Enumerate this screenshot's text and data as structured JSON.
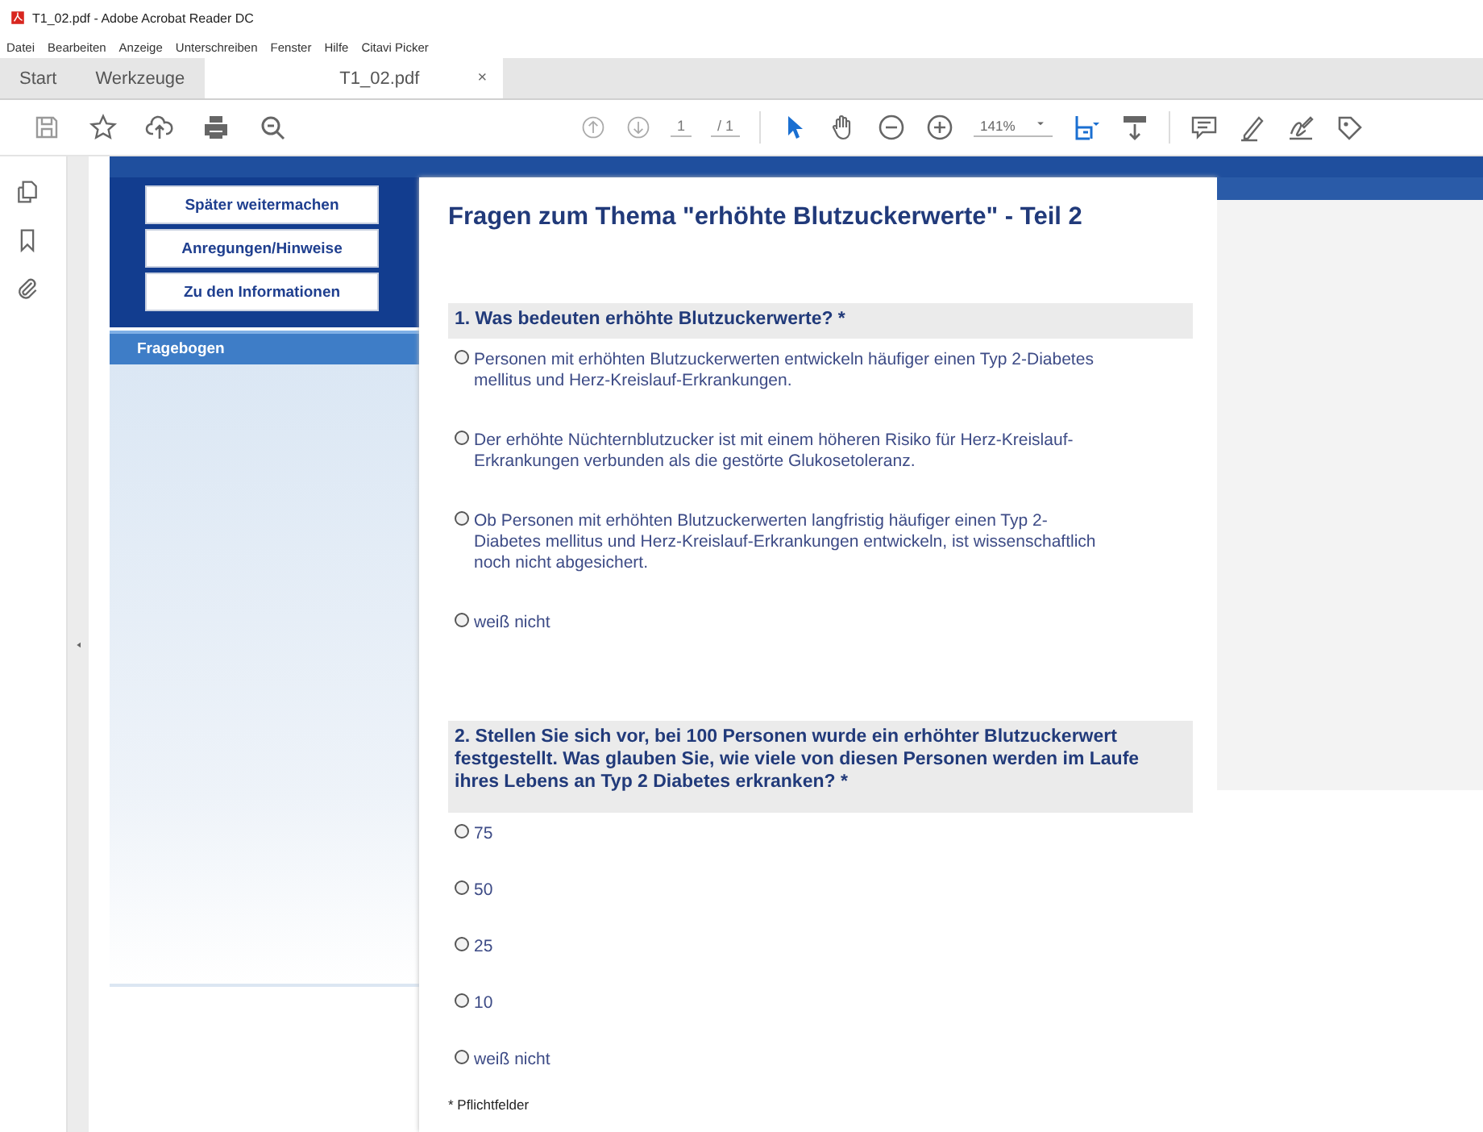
{
  "window": {
    "title": "T1_02.pdf - Adobe Acrobat Reader DC"
  },
  "menu": [
    "Datei",
    "Bearbeiten",
    "Anzeige",
    "Unterschreiben",
    "Fenster",
    "Hilfe",
    "Citavi Picker"
  ],
  "tabs": [
    {
      "label": "Start",
      "selected": false
    },
    {
      "label": "Werkzeuge",
      "selected": false
    },
    {
      "label": "T1_02.pdf",
      "selected": true,
      "close": "×"
    }
  ],
  "toolbar": {
    "page": "1",
    "page_total": "/ 1",
    "zoom": "141%"
  },
  "survey_nav": {
    "buttons": [
      "Später weitermachen",
      "Anregungen/Hinweise",
      "Zu den Informationen"
    ],
    "section": "Fragebogen"
  },
  "page": {
    "title": "Fragen zum Thema \"erhöhte Blutzuckerwerte\" - Teil 2",
    "questions": [
      {
        "text": "1. Was bedeuten erhöhte Blutzuckerwerte? *",
        "options": [
          {
            "label": "Personen mit erhöhten Blutzuckerwerten entwickeln häufiger einen Typ 2-Diabetes mellitus und Herz-Kreislauf-Erkrankungen.",
            "selected": false
          },
          {
            "label": "Der erhöhte Nüchternblutzucker ist mit einem höheren Risiko für Herz-Kreislauf-Erkrankungen verbunden als die gestörte Glukosetoleranz.",
            "selected": false
          },
          {
            "label": "Ob Personen mit erhöhten Blutzuckerwerten langfristig häufiger einen Typ 2-Diabetes mellitus und Herz-Kreislauf-Erkrankungen entwickeln, ist wissenschaftlich noch nicht abgesichert.",
            "selected": false
          },
          {
            "label": "weiß nicht",
            "selected": false
          }
        ]
      },
      {
        "text": "2. Stellen Sie sich vor, bei 100 Personen wurde ein erhöhter Blutzuckerwert festgestellt. Was glauben Sie, wie viele von diesen Personen werden im Laufe ihres Lebens an Typ 2 Diabetes erkranken? *",
        "options": [
          {
            "label": "75",
            "selected": false
          },
          {
            "label": "50",
            "selected": false
          },
          {
            "label": "25",
            "selected": false
          },
          {
            "label": "10",
            "selected": false
          },
          {
            "label": "weiß nicht",
            "selected": false
          }
        ]
      }
    ],
    "footnote": "* Pflichtfelder"
  }
}
